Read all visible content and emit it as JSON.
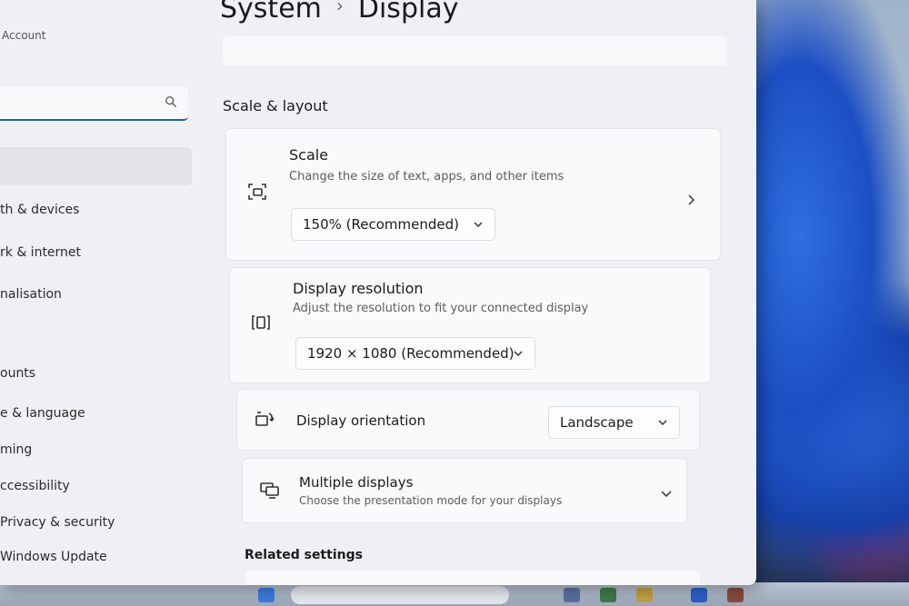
{
  "sidebar": {
    "account_label": "Account",
    "search_placeholder": "",
    "items": [
      {
        "label": "th & devices"
      },
      {
        "label": "rk & internet"
      },
      {
        "label": "nalisation"
      },
      {
        "label": "ounts"
      },
      {
        "label": "e & language"
      },
      {
        "label": "ming"
      },
      {
        "label": "ccessibility"
      },
      {
        "label": "Privacy & security"
      },
      {
        "label": "Windows Update"
      }
    ]
  },
  "header": {
    "breadcrumb_parent": "System",
    "breadcrumb_separator": "›",
    "breadcrumb_current": "Display"
  },
  "main": {
    "section_title": "Scale & layout",
    "scale": {
      "title": "Scale",
      "description": "Change the size of text, apps, and other items",
      "value": "150% (Recommended)",
      "icon": "scale-icon"
    },
    "resolution": {
      "title": "Display resolution",
      "description": "Adjust the resolution to fit your connected display",
      "value": "1920 × 1080 (Recommended)",
      "icon": "resolution-icon"
    },
    "orientation": {
      "title": "Display orientation",
      "value": "Landscape",
      "icon": "orientation-icon"
    },
    "multiple": {
      "title": "Multiple displays",
      "description": "Choose the presentation mode for your displays",
      "icon": "multiple-displays-icon"
    },
    "related_title": "Related settings"
  },
  "colors": {
    "accent": "#1f62b3",
    "window_bg": "#eef0f3",
    "card_bg": "#f9fafb"
  }
}
